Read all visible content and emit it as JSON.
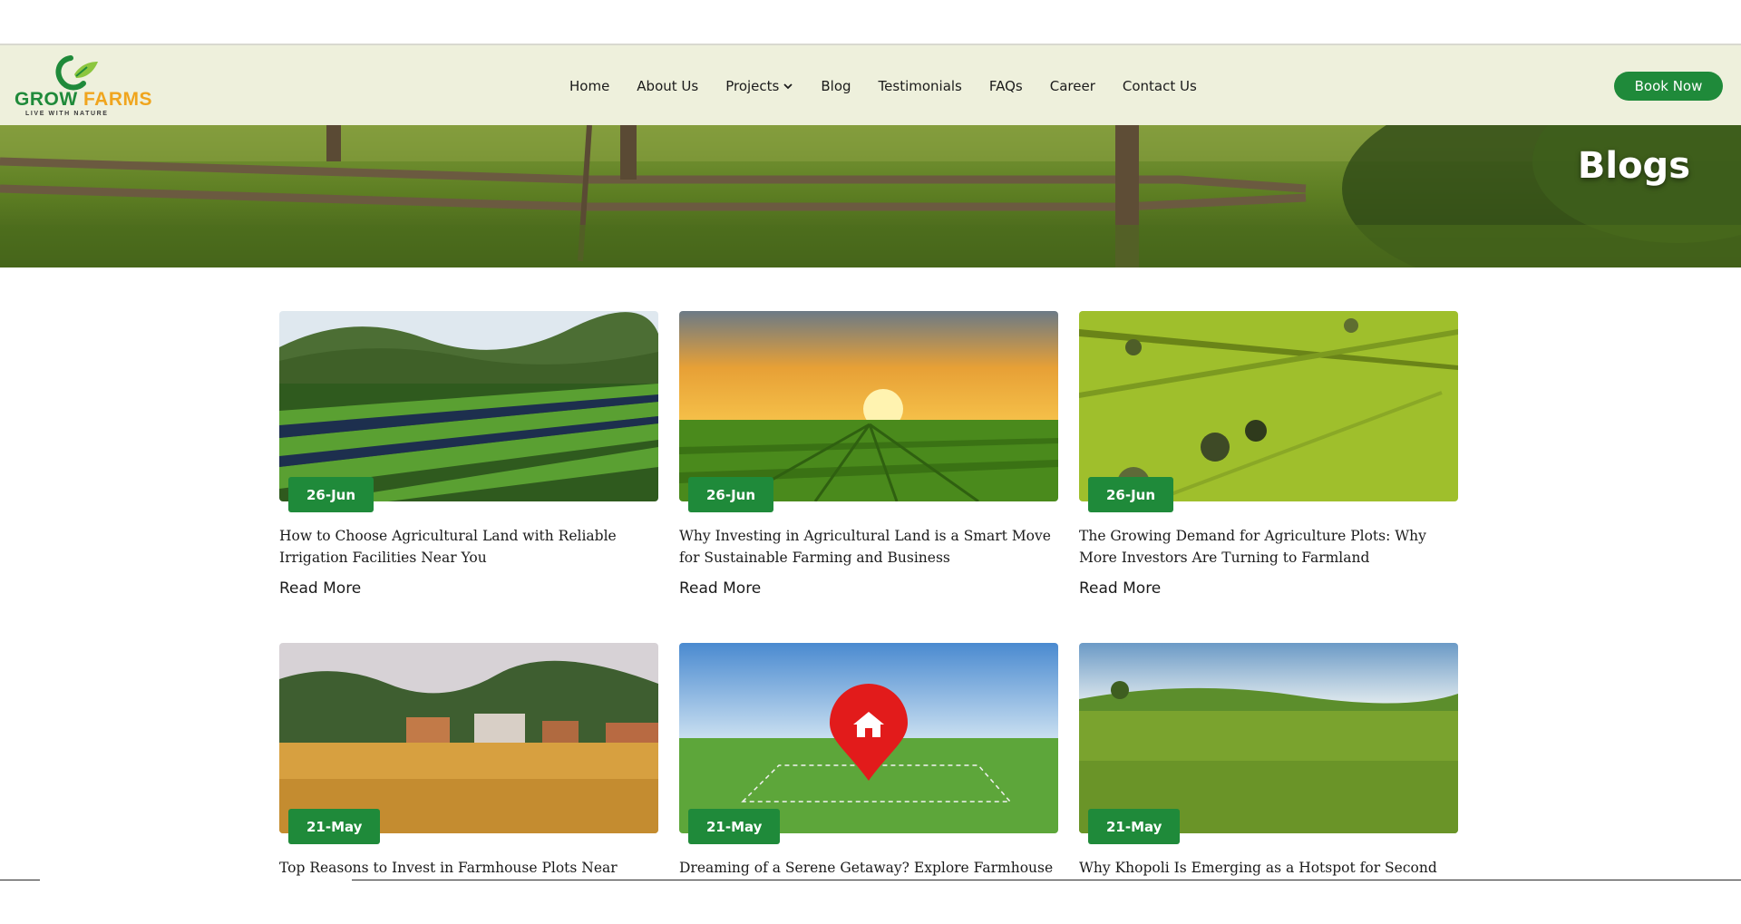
{
  "brand": {
    "word1": "GROW",
    "word2": "FARMS",
    "tagline": "LIVE WITH NATURE"
  },
  "nav": {
    "items": [
      {
        "label": "Home"
      },
      {
        "label": "About Us"
      },
      {
        "label": "Projects"
      },
      {
        "label": "Blog"
      },
      {
        "label": "Testimonials"
      },
      {
        "label": "FAQs"
      },
      {
        "label": "Career"
      },
      {
        "label": "Contact Us"
      }
    ],
    "book_label": "Book Now"
  },
  "hero": {
    "title": "Blogs"
  },
  "colors": {
    "accent": "#1f8a3a",
    "header_bg": "#eef0dc",
    "logo_orange": "#f0a51e"
  },
  "posts": [
    {
      "date": "26-Jun",
      "title": "How to Choose Agricultural Land with Reliable Irrigation Facilities Near You",
      "read_more": "Read More",
      "image": "strawberry-field-rows"
    },
    {
      "date": "26-Jun",
      "title": "Why Investing in Agricultural Land is a Smart Move for Sustainable Farming and Business",
      "read_more": "Read More",
      "image": "sunset-over-green-field"
    },
    {
      "date": "26-Jun",
      "title": "The Growing Demand for Agriculture Plots: Why More Investors Are Turning to Farmland",
      "read_more": "Read More",
      "image": "aerial-green-farmland"
    },
    {
      "date": "21-May",
      "title": "Top Reasons to Invest in Farmhouse Plots Near Mumbai &",
      "read_more": "",
      "image": "farmhouses-and-golden-field"
    },
    {
      "date": "21-May",
      "title": "Dreaming of a Serene Getaway? Explore Farmhouse Plots",
      "read_more": "",
      "image": "plot-pin-on-grass"
    },
    {
      "date": "21-May",
      "title": "Why Khopoli Is Emerging as a Hotspot for Second Homes",
      "read_more": "",
      "image": "rolling-wheat-field"
    }
  ]
}
